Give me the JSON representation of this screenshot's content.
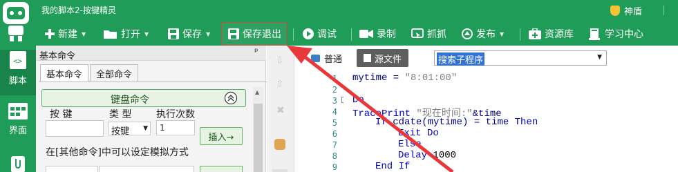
{
  "window": {
    "title": "我的脚本2-按键精灵",
    "shield_label": "神盾"
  },
  "toolbar": {
    "new": "新建",
    "open": "打开",
    "save": "保存",
    "save_exit": "保存退出",
    "debug": "调试",
    "record": "录制",
    "capture": "抓抓",
    "publish": "发布",
    "resources": "资源库",
    "learning": "学习中心"
  },
  "rail": {
    "script": "脚本",
    "ui": "界面"
  },
  "panel": {
    "title": "基本命令",
    "pin": "ᵖ",
    "tab_basic": "基本命令",
    "tab_all": "全部命令",
    "keyboard_group": "键盘命令",
    "col_key": "按 键",
    "col_type": "类 型",
    "col_count": "执行次数",
    "type_value": "按键",
    "count_value": "1",
    "insert": "插入→",
    "hint": "在[其他命令]中可以设定模拟方式"
  },
  "editor": {
    "mode_normal": "普通",
    "mode_source": "源文件",
    "search_placeholder": "搜索子程序",
    "lines": [
      "1",
      "2",
      "3",
      "4",
      "5",
      "6",
      "7",
      "8",
      "9"
    ],
    "code": {
      "l1a": "mytime = ",
      "l1b": "\"8:01:00\"",
      "l3": "Do",
      "l4a": "TracePrint ",
      "l4b": "\"现在时间:\"",
      "l4c": "&time",
      "l5a": "If ",
      "l5b": "cdate(mytime) = time ",
      "l5c": "Then",
      "l6": "Exit Do",
      "l7": "Else",
      "l8a": "Delay ",
      "l8b": "1000",
      "l9": "End If"
    }
  },
  "colors": {
    "brand_green": "#1f9c58",
    "arrow_red": "#e8383b"
  }
}
